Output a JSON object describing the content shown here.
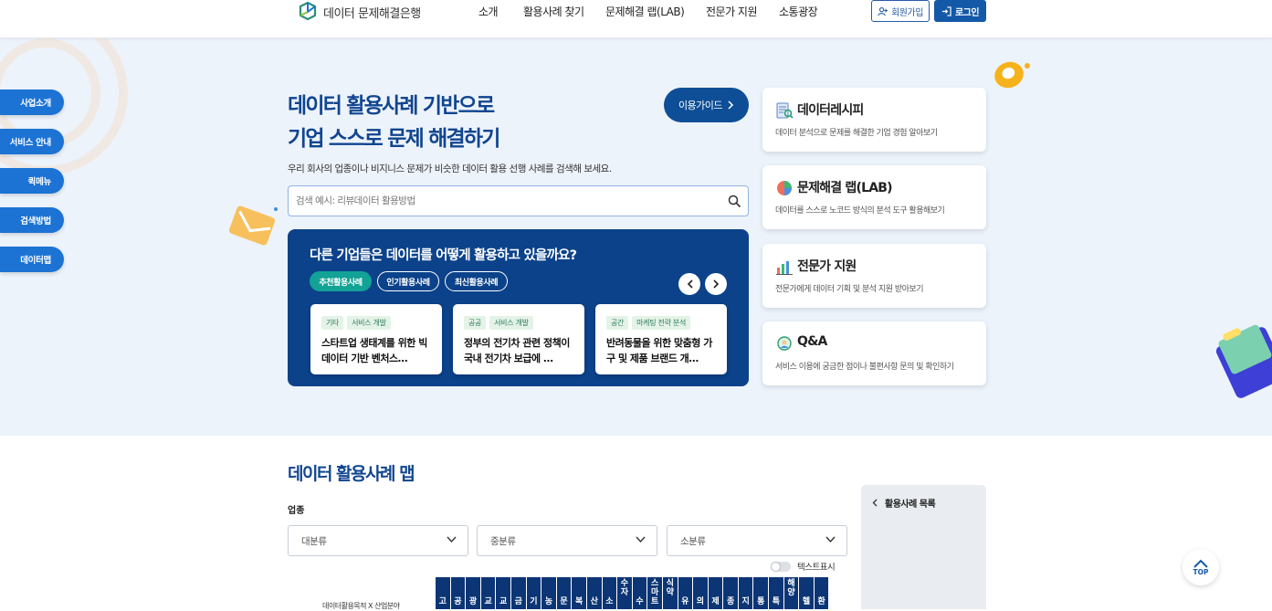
{
  "header": {
    "logo_text": "데이터 문제해결은행",
    "nav": [
      "소개",
      "활용사례 찾기",
      "문제해결 랩(LAB)",
      "전문가 지원",
      "소통광장"
    ],
    "join_label": "회원가입",
    "login_label": "로그인"
  },
  "side_menu": [
    "사업소개",
    "서비스 안내",
    "퀵메뉴",
    "검색방법",
    "데이터맵"
  ],
  "hero": {
    "title_line1": "데이터 활용사례 기반으로",
    "title_line2": "기업 스스로 문제 해결하기",
    "guide_label": "이용가이드",
    "description": "우리 회사의 업종이나 비지니스 문제가 비슷한 데이터 활용 선행 사례를 검색해 보세요.",
    "search_placeholder": "검색 예시: 리뷰데이터 활용방법"
  },
  "cases": {
    "title": "다른 기업들은 데이터를 어떻게 활용하고 있을까요?",
    "tabs": [
      "추천활용사례",
      "인기활용사례",
      "최신활용사례"
    ],
    "active_tab": 0,
    "cards": [
      {
        "tag1": "기타",
        "tag2": "서비스 개발",
        "title": "스타트업 생태계를 위한 빅데이터 기반 벤처스…"
      },
      {
        "tag1": "공공",
        "tag2": "서비스 개발",
        "title": "정부의 전기차 관련 정책이 국내 전기차 보급에 …"
      },
      {
        "tag1": "공간",
        "tag2": "마케팅 전략 분석",
        "title": "반려동물을 위한 맞춤형 가구 및 제품 브랜드 개…"
      }
    ]
  },
  "services": [
    {
      "title": "데이터레시피",
      "desc": "데이터 분석으로 문제를 해결한 기업 경험 알아보기",
      "icon": "recipe-icon"
    },
    {
      "title": "문제해결 랩(LAB)",
      "desc": "데이터를 스스로 노코드 방식의 분석 도구 활용해보기",
      "icon": "lab-icon"
    },
    {
      "title": "전문가 지원",
      "desc": "전문가에게 데이터 기획 및 분석 지원 받아보기",
      "icon": "expert-icon"
    },
    {
      "title": "Q&A",
      "desc": "서비스 이용에 궁금한 점이나 불편사항 문의 및 확인하기",
      "icon": "qna-icon"
    }
  ],
  "map": {
    "title": "데이터 활용사례 맵",
    "field_label": "업종",
    "selects": [
      "대분류",
      "중분류",
      "소분류"
    ],
    "toggle_label": "텍스트표시",
    "axis_label": "데이터활용목적 X 산업분야",
    "columns": [
      "고",
      "공",
      "광",
      "교",
      "교",
      "금",
      "기",
      "농",
      "문",
      "복",
      "산",
      "소",
      "수자",
      "수",
      "스마트",
      "식약",
      "유",
      "의",
      "제",
      "종",
      "지",
      "통",
      "특",
      "해양",
      "헬",
      "환"
    ],
    "panel_title": "활용사례 목록"
  },
  "top_label": "TOP"
}
